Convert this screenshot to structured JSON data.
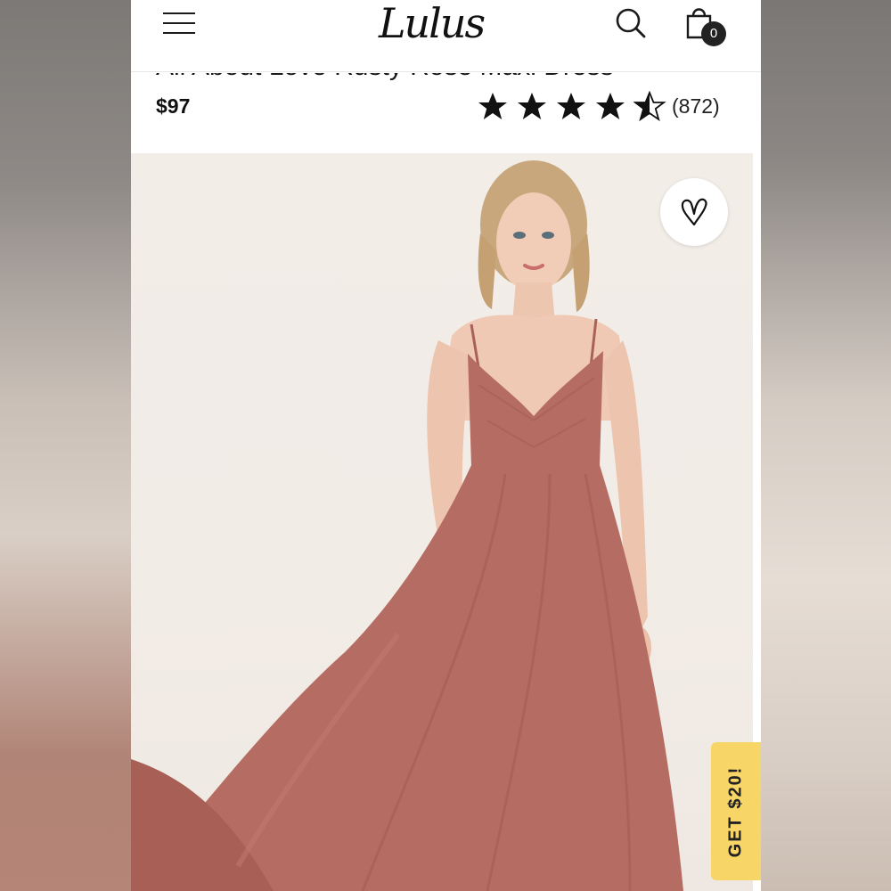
{
  "header": {
    "logo_text": "Lulus",
    "cart_count": "0",
    "icons": [
      "hamburger-menu-icon",
      "search-icon",
      "shopping-bag-icon"
    ]
  },
  "product": {
    "title": "All About Love Rusty Rose Maxi Dress",
    "price": "$97",
    "rating": 4.5,
    "rating_max": 5,
    "review_count": "(872)"
  },
  "favorite": {
    "icon": "heart-icon"
  },
  "promo": {
    "label": "GET $20!"
  },
  "colors": {
    "dress": "#b56d63",
    "promo": "#f8d567",
    "text": "#111111"
  }
}
